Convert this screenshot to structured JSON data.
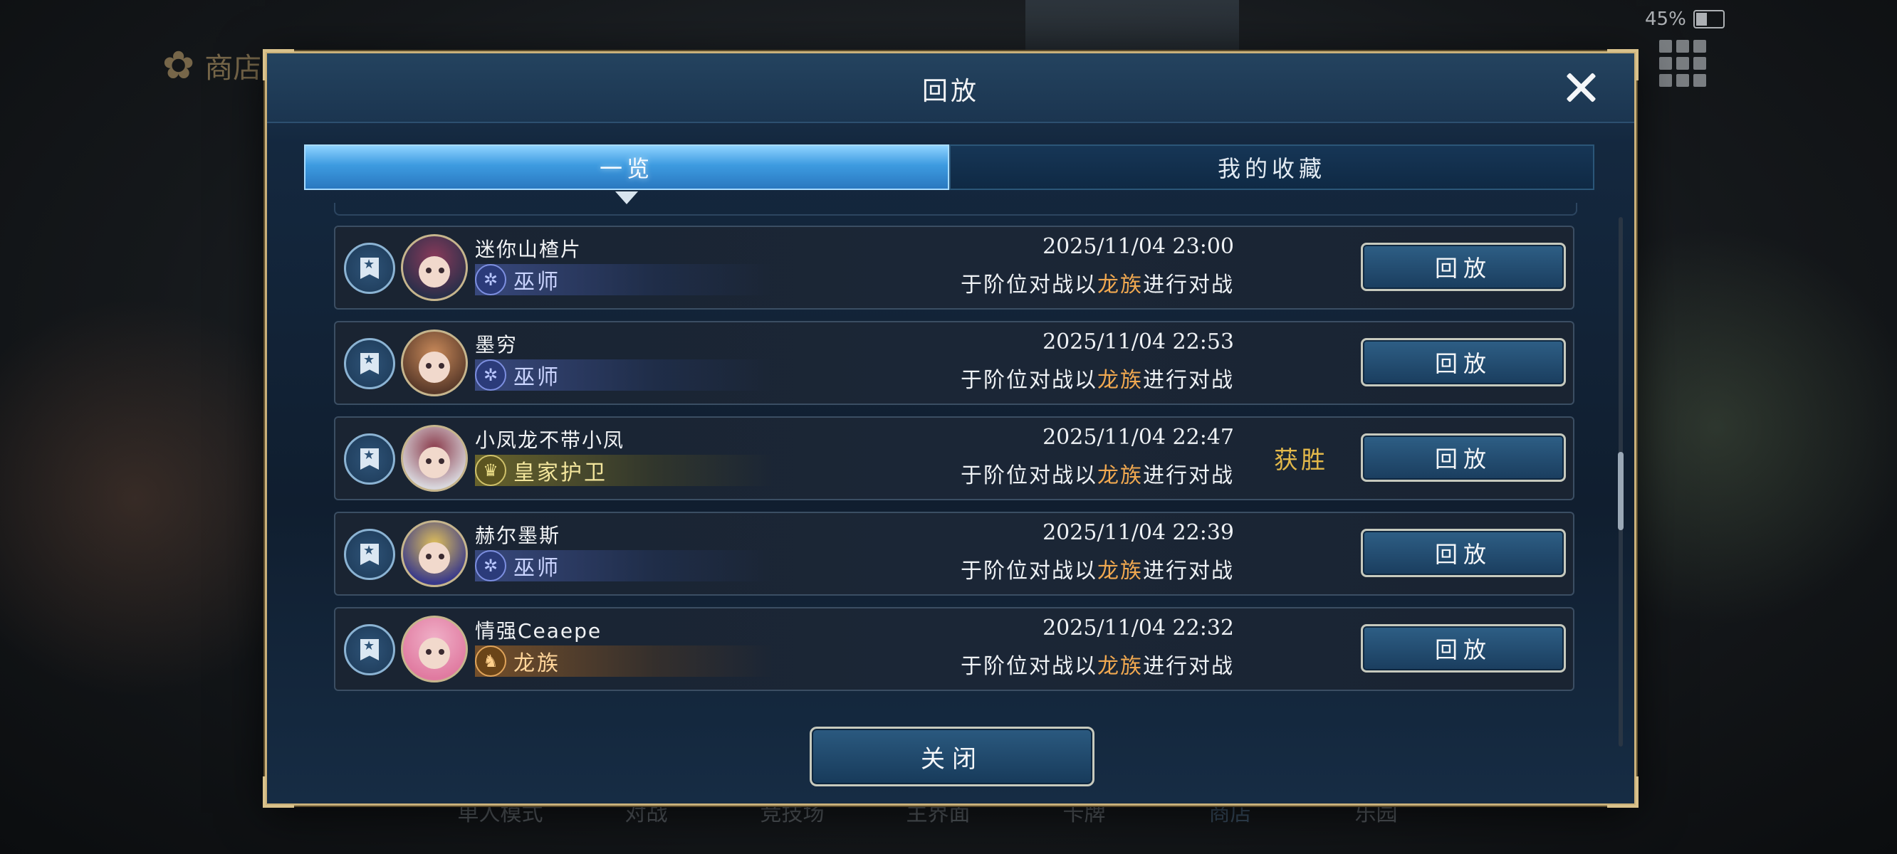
{
  "background": {
    "shop_label": "商店",
    "battery": "45%",
    "battery_level": 0.45,
    "bottom_nav": [
      "单人模式",
      "对战",
      "竞技场",
      "主界面",
      "卡牌",
      "商店",
      "乐园"
    ]
  },
  "dialog": {
    "title": "回放",
    "tabs": [
      {
        "label": "一览",
        "active": true
      },
      {
        "label": "我的收藏",
        "active": false
      }
    ],
    "close_button": "关闭"
  },
  "replays": [
    {
      "player": "迷你山楂片",
      "class": "巫师",
      "class_type": "mage",
      "class_icon": "mage-icon",
      "time": "2025/11/04  23:00",
      "desc_prefix": "于阶位对战以",
      "clan": "龙族",
      "desc_suffix": "进行对战",
      "result": "",
      "button": "回放"
    },
    {
      "player": "墨穷",
      "class": "巫师",
      "class_type": "mage",
      "class_icon": "mage-icon",
      "time": "2025/11/04  22:53",
      "desc_prefix": "于阶位对战以",
      "clan": "龙族",
      "desc_suffix": "进行对战",
      "result": "",
      "button": "回放"
    },
    {
      "player": "小凤龙不带小凤",
      "class": "皇家护卫",
      "class_type": "royal",
      "class_icon": "crown-icon",
      "time": "2025/11/04  22:47",
      "desc_prefix": "于阶位对战以",
      "clan": "龙族",
      "desc_suffix": "进行对战",
      "result": "获胜",
      "button": "回放"
    },
    {
      "player": "赫尔墨斯",
      "class": "巫师",
      "class_type": "mage",
      "class_icon": "mage-icon",
      "time": "2025/11/04  22:39",
      "desc_prefix": "于阶位对战以",
      "clan": "龙族",
      "desc_suffix": "进行对战",
      "result": "",
      "button": "回放"
    },
    {
      "player": "情强Ceaepe",
      "class": "龙族",
      "class_type": "dragon",
      "class_icon": "dragon-icon",
      "time": "2025/11/04  22:32",
      "desc_prefix": "于阶位对战以",
      "clan": "龙族",
      "desc_suffix": "进行对战",
      "result": "",
      "button": "回放"
    }
  ],
  "colors": {
    "frame_gold": "#c9b07a",
    "tab_active_blue": "#3d9be0",
    "clan_orange": "#f0a850",
    "win_gold": "#e2b84a"
  }
}
